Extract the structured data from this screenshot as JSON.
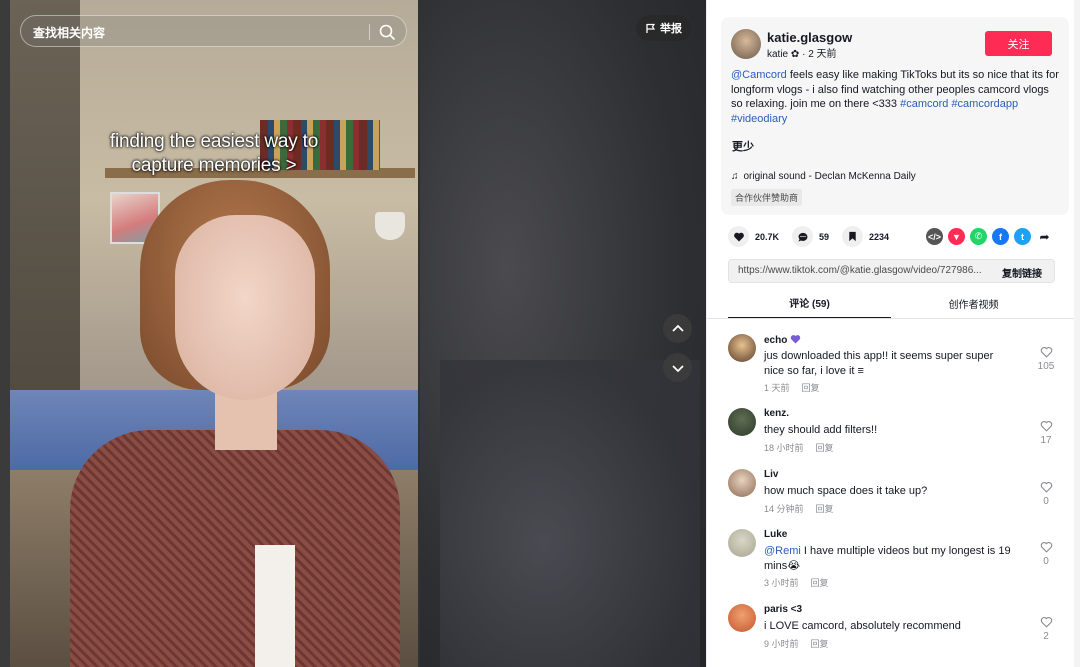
{
  "search": {
    "placeholder": "查找相关内容"
  },
  "report": {
    "label": "举报"
  },
  "video": {
    "caption_line1": "finding the easiest way to",
    "caption_line2": "capture memories >"
  },
  "author": {
    "username": "katie.glasgow",
    "display_name": "katie",
    "time_ago": "2 天前",
    "follow_label": "关注"
  },
  "description": {
    "mention": "@Camcord",
    "text": " feels easy like making TikToks but its so nice that its for longform vlogs - i also find watching other peoples camcord vlogs so relaxing. join me on there <333 ",
    "tag1": "#camcord",
    "tag2": "#camcordapp",
    "tag3": "#videodiary",
    "less_label": "更少"
  },
  "music": {
    "title": "original sound - Declan McKenna Daily"
  },
  "partner_label": "合作伙伴赞助商",
  "stats": {
    "likes": "20.7K",
    "comments": "59",
    "saves": "2234"
  },
  "link": {
    "url": "https://www.tiktok.com/@katie.glasgow/video/727986...",
    "copy_label": "复制链接"
  },
  "tabs": {
    "comments": "评论 (59)",
    "creator_videos": "创作者视频"
  },
  "comments": [
    {
      "name": "echo",
      "text": "jus downloaded this app!! it seems super super nice so far, i love it ≡",
      "time": "1 天前",
      "reply": "回复",
      "likes": "105"
    },
    {
      "name": "kenz.",
      "text": "they should add filters!!",
      "time": "18 小时前",
      "reply": "回复",
      "likes": "17"
    },
    {
      "name": "Liv",
      "text": "how much space does it take up?",
      "time": "14 分钟前",
      "reply": "回复",
      "likes": "0"
    },
    {
      "name": "Luke",
      "mention": "@Remi",
      "text": " I have multiple videos but my longest is 19 mins😭",
      "time": "3 小时前",
      "reply": "回复",
      "likes": "0"
    },
    {
      "name": "paris <3",
      "text": "i LOVE camcord, absolutely recommend",
      "time": "9 小时前",
      "reply": "回复",
      "likes": "2"
    }
  ],
  "colors": {
    "follow": "#fe2c55",
    "tag": "#2b5db9",
    "echo_badge": "#7b5cd6"
  }
}
